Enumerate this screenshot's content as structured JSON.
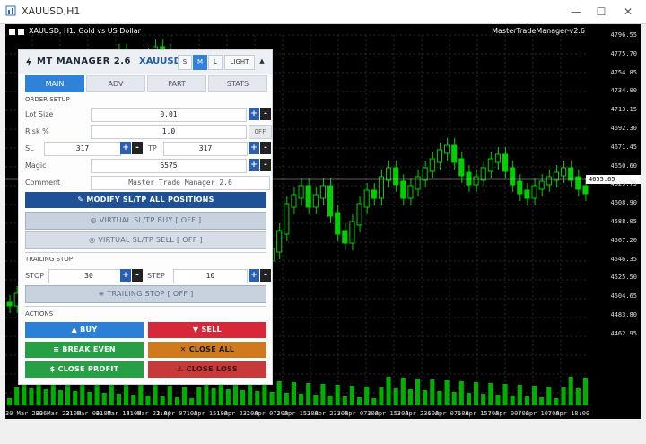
{
  "window": {
    "title": "XAUUSD,H1",
    "min": "—",
    "max": "☐",
    "close": "✕"
  },
  "chart": {
    "info": "XAUUSD, H1:  Gold vs US Dollar",
    "ea_label": "MasterTradeManager-v2.6",
    "y_labels": [
      "4796.55",
      "4775.70",
      "4754.85",
      "4734.00",
      "4713.15",
      "4692.30",
      "4671.45",
      "4650.60",
      "4629.75",
      "4608.90",
      "4588.05",
      "4567.20",
      "4546.35",
      "4525.50",
      "4504.65",
      "4483.80",
      "4462.95"
    ],
    "current_price": "4655.65",
    "x_labels": [
      "30 Mar 2026",
      "30 Mar 22:00",
      "31 Mar 06:00",
      "31 Mar 14:00",
      "31 Mar 22:00",
      "1 Apr 07:00",
      "1 Apr 15:00",
      "1 Apr 23:00",
      "2 Apr 07:00",
      "2 Apr 15:00",
      "2 Apr 23:00",
      "3 Apr 07:00",
      "3 Apr 15:00",
      "3 Apr 23:00",
      "6 Apr 07:00",
      "6 Apr 15:00",
      "7 Apr 00:00",
      "7 Apr 10:00",
      "7 Apr 18:00"
    ],
    "colors": {
      "background": "#000000",
      "bull": "#00e000",
      "bear": "#00e000",
      "volume": "#00c000"
    }
  },
  "panel": {
    "title": "MT MANAGER  2.6",
    "symbol": "XAUUSD",
    "theme_s": "S",
    "theme_m": "M",
    "theme_l": "L",
    "light": "LIGHT",
    "collapse": "▲",
    "tabs": [
      "MAIN",
      "ADV",
      "PART",
      "STATS"
    ],
    "order_setup": "ORDER SETUP",
    "lot_label": "Lot Size",
    "lot_value": "0.01",
    "risk_label": "Risk %",
    "risk_value": "1.0",
    "risk_toggle": "OFF",
    "sl_label": "SL",
    "sl_value": "317",
    "tp_label": "TP",
    "tp_value": "317",
    "magic_label": "Magic",
    "magic_value": "6575",
    "comment_label": "Comment",
    "comment_value": "Master Trade Manager 2.6",
    "modify_btn": "MODIFY SL/TP  ALL POSITIONS",
    "vsltp_buy": "VIRTUAL SL/TP BUY   [ OFF ]",
    "vsltp_sell": "VIRTUAL SL/TP SELL  [ OFF ]",
    "trailing_stop_head": "TRAILING STOP",
    "stop_label": "STOP",
    "stop_value": "30",
    "step_label": "STEP",
    "step_value": "10",
    "trailing_btn": "TRAILING STOP  [ OFF ]",
    "actions_head": "ACTIONS",
    "buy_btn": "BUY",
    "sell_btn": "SELL",
    "break_even_btn": "BREAK EVEN",
    "close_all_btn": "CLOSE ALL",
    "close_profit_btn": "CLOSE PROFIT",
    "close_loss_btn": "CLOSE LOSS",
    "plus": "+",
    "minus": "-",
    "colors": {
      "accent": "#2f82d8",
      "buy": "#2b7fd6",
      "sell": "#d62839",
      "break_even": "#27a045",
      "close_all": "#cf7a1c",
      "close_profit": "#27a045",
      "close_loss": "#c83a3a"
    }
  }
}
